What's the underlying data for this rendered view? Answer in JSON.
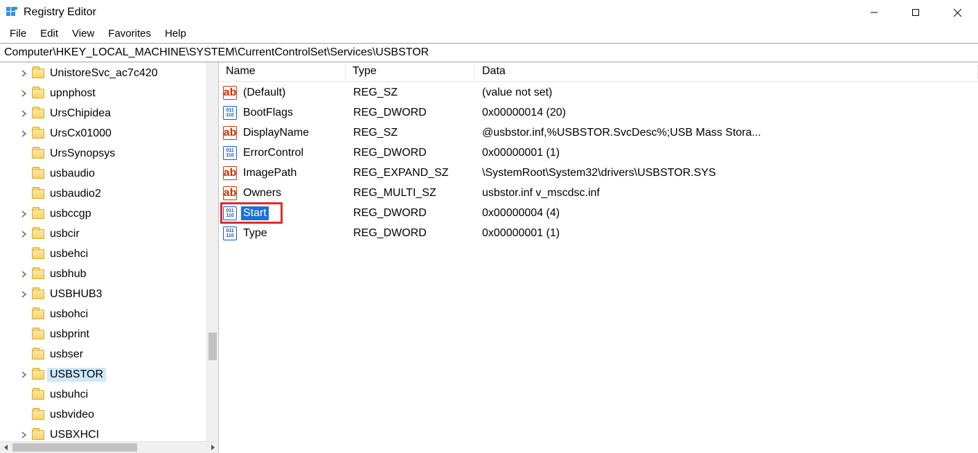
{
  "window": {
    "title": "Registry Editor"
  },
  "menu": {
    "file": "File",
    "edit": "Edit",
    "view": "View",
    "favorites": "Favorites",
    "help": "Help"
  },
  "address": "Computer\\HKEY_LOCAL_MACHINE\\SYSTEM\\CurrentControlSet\\Services\\USBSTOR",
  "tree": {
    "items": [
      {
        "label": "UnistoreSvc_ac7c420",
        "expandable": true,
        "selected": false
      },
      {
        "label": "upnphost",
        "expandable": true,
        "selected": false
      },
      {
        "label": "UrsChipidea",
        "expandable": true,
        "selected": false
      },
      {
        "label": "UrsCx01000",
        "expandable": true,
        "selected": false
      },
      {
        "label": "UrsSynopsys",
        "expandable": false,
        "selected": false
      },
      {
        "label": "usbaudio",
        "expandable": false,
        "selected": false
      },
      {
        "label": "usbaudio2",
        "expandable": false,
        "selected": false
      },
      {
        "label": "usbccgp",
        "expandable": true,
        "selected": false
      },
      {
        "label": "usbcir",
        "expandable": true,
        "selected": false
      },
      {
        "label": "usbehci",
        "expandable": false,
        "selected": false
      },
      {
        "label": "usbhub",
        "expandable": true,
        "selected": false
      },
      {
        "label": "USBHUB3",
        "expandable": true,
        "selected": false
      },
      {
        "label": "usbohci",
        "expandable": false,
        "selected": false
      },
      {
        "label": "usbprint",
        "expandable": false,
        "selected": false
      },
      {
        "label": "usbser",
        "expandable": false,
        "selected": false
      },
      {
        "label": "USBSTOR",
        "expandable": true,
        "selected": true
      },
      {
        "label": "usbuhci",
        "expandable": false,
        "selected": false
      },
      {
        "label": "usbvideo",
        "expandable": false,
        "selected": false
      },
      {
        "label": "USBXHCI",
        "expandable": true,
        "selected": false
      }
    ]
  },
  "list": {
    "columns": {
      "name": "Name",
      "type": "Type",
      "data": "Data"
    },
    "rows": [
      {
        "name": "(Default)",
        "icon": "sz",
        "type": "REG_SZ",
        "data": "(value not set)",
        "selected": false,
        "highlighted": false
      },
      {
        "name": "BootFlags",
        "icon": "dw",
        "type": "REG_DWORD",
        "data": "0x00000014 (20)",
        "selected": false,
        "highlighted": false
      },
      {
        "name": "DisplayName",
        "icon": "sz",
        "type": "REG_SZ",
        "data": "@usbstor.inf,%USBSTOR.SvcDesc%;USB Mass Stora...",
        "selected": false,
        "highlighted": false
      },
      {
        "name": "ErrorControl",
        "icon": "dw",
        "type": "REG_DWORD",
        "data": "0x00000001 (1)",
        "selected": false,
        "highlighted": false
      },
      {
        "name": "ImagePath",
        "icon": "sz",
        "type": "REG_EXPAND_SZ",
        "data": "\\SystemRoot\\System32\\drivers\\USBSTOR.SYS",
        "selected": false,
        "highlighted": false
      },
      {
        "name": "Owners",
        "icon": "sz",
        "type": "REG_MULTI_SZ",
        "data": "usbstor.inf v_mscdsc.inf",
        "selected": false,
        "highlighted": false
      },
      {
        "name": "Start",
        "icon": "dw",
        "type": "REG_DWORD",
        "data": "0x00000004 (4)",
        "selected": true,
        "highlighted": true
      },
      {
        "name": "Type",
        "icon": "dw",
        "type": "REG_DWORD",
        "data": "0x00000001 (1)",
        "selected": false,
        "highlighted": false
      }
    ]
  }
}
